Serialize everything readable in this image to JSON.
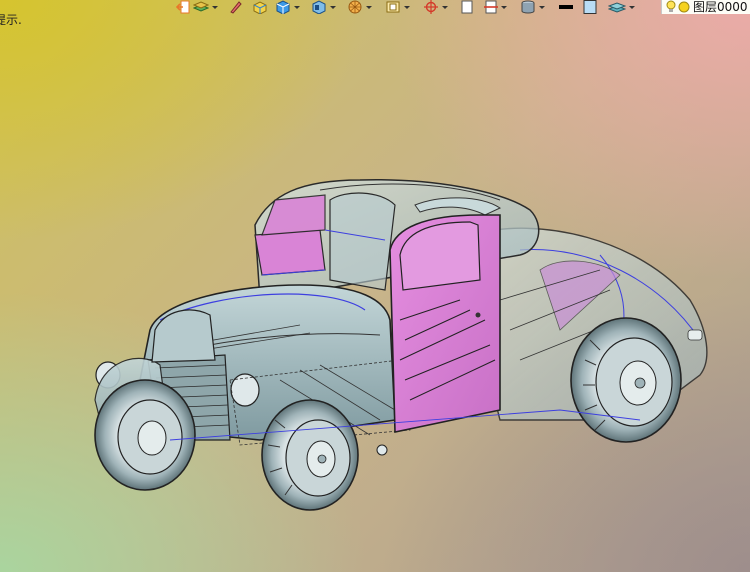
{
  "viewport": {
    "hint_text": "提示."
  },
  "toolbar": {
    "items": [
      {
        "icon": "exit-icon"
      },
      {
        "icon": "layers-stack-icon",
        "dropdown": true
      },
      {
        "icon": "pencil-icon"
      },
      {
        "icon": "box-yellow-icon"
      },
      {
        "icon": "cube-blue-icon",
        "dropdown": true
      },
      {
        "icon": "cube-view-icon",
        "dropdown": true
      },
      {
        "icon": "wireframe-sphere-icon",
        "dropdown": true
      },
      {
        "icon": "frame-icon",
        "dropdown": true
      },
      {
        "icon": "crosshair-icon",
        "dropdown": true
      },
      {
        "icon": "page-icon"
      },
      {
        "icon": "section-icon",
        "dropdown": true
      },
      {
        "icon": "cylinder-icon",
        "dropdown": true
      },
      {
        "icon": "line-weight-icon"
      },
      {
        "icon": "color-swatch-icon"
      },
      {
        "icon": "layer-stack-icon",
        "dropdown": true
      }
    ],
    "colors": {
      "accent_orange": "#e8772a",
      "accent_blue": "#2a7fd4",
      "swatch": "#b9dcf5"
    }
  },
  "layer": {
    "label": "图层0000"
  },
  "model": {
    "body_color": "#a9c3c8",
    "door_color": "#d984d6",
    "outline_color": "#222222",
    "highlight_color": "#3d3fe0"
  }
}
